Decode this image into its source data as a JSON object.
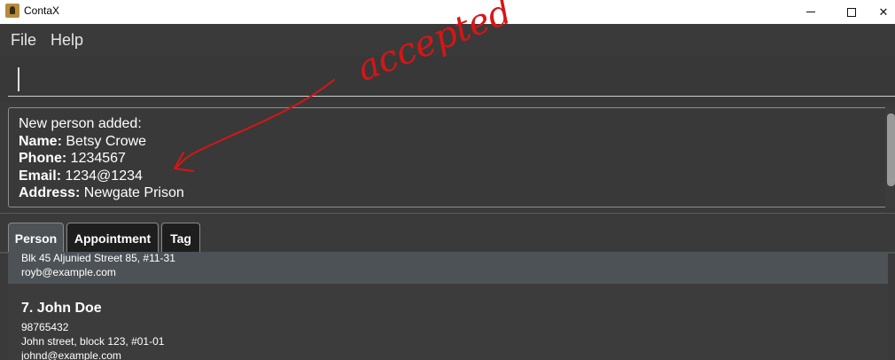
{
  "window": {
    "title": "ContaX"
  },
  "menu": {
    "file": "File",
    "help": "Help"
  },
  "command": {
    "value": "",
    "placeholder": ""
  },
  "result": {
    "intro": "New person added:",
    "fields": [
      {
        "label": "Name:",
        "value": " Betsy Crowe"
      },
      {
        "label": "Phone:",
        "value": " 1234567"
      },
      {
        "label": "Email:",
        "value": " 1234@1234"
      },
      {
        "label": "Address:",
        "value": " Newgate Prison"
      }
    ]
  },
  "tabs": [
    {
      "label": "Person",
      "selected": true
    },
    {
      "label": "Appointment",
      "selected": false
    },
    {
      "label": "Tag",
      "selected": false
    }
  ],
  "persons": [
    {
      "address": "Blk 45 Aljunied Street 85, #11-31",
      "email": "royb@example.com"
    },
    {
      "index_name": "7.  John Doe",
      "phone": "98765432",
      "address": "John street, block 123, #01-01",
      "email": "johnd@example.com"
    }
  ],
  "annotation": {
    "text": "accepted",
    "color": "#d81515"
  },
  "colors": {
    "background": "#3a3a3a",
    "selected_card": "#4d5256",
    "text": "#ffffff"
  }
}
